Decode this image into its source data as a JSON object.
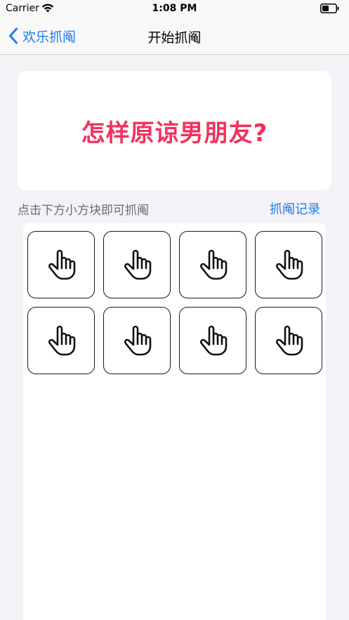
{
  "status_bar": {
    "carrier": "Carrier",
    "time": "1:08 PM"
  },
  "nav": {
    "back_label": "欢乐抓阄",
    "title": "开始抓阄"
  },
  "question": {
    "text": "怎样原谅男朋友?"
  },
  "hint": {
    "text": "点击下方小方块即可抓阄",
    "records_link": "抓阄记录"
  },
  "grid": {
    "tile_icon": "hand-pointer-icon",
    "tile_count": 8
  },
  "colors": {
    "accent_blue": "#1e7cf2",
    "question_pink": "#f4305f",
    "background": "#f2f2f7"
  }
}
